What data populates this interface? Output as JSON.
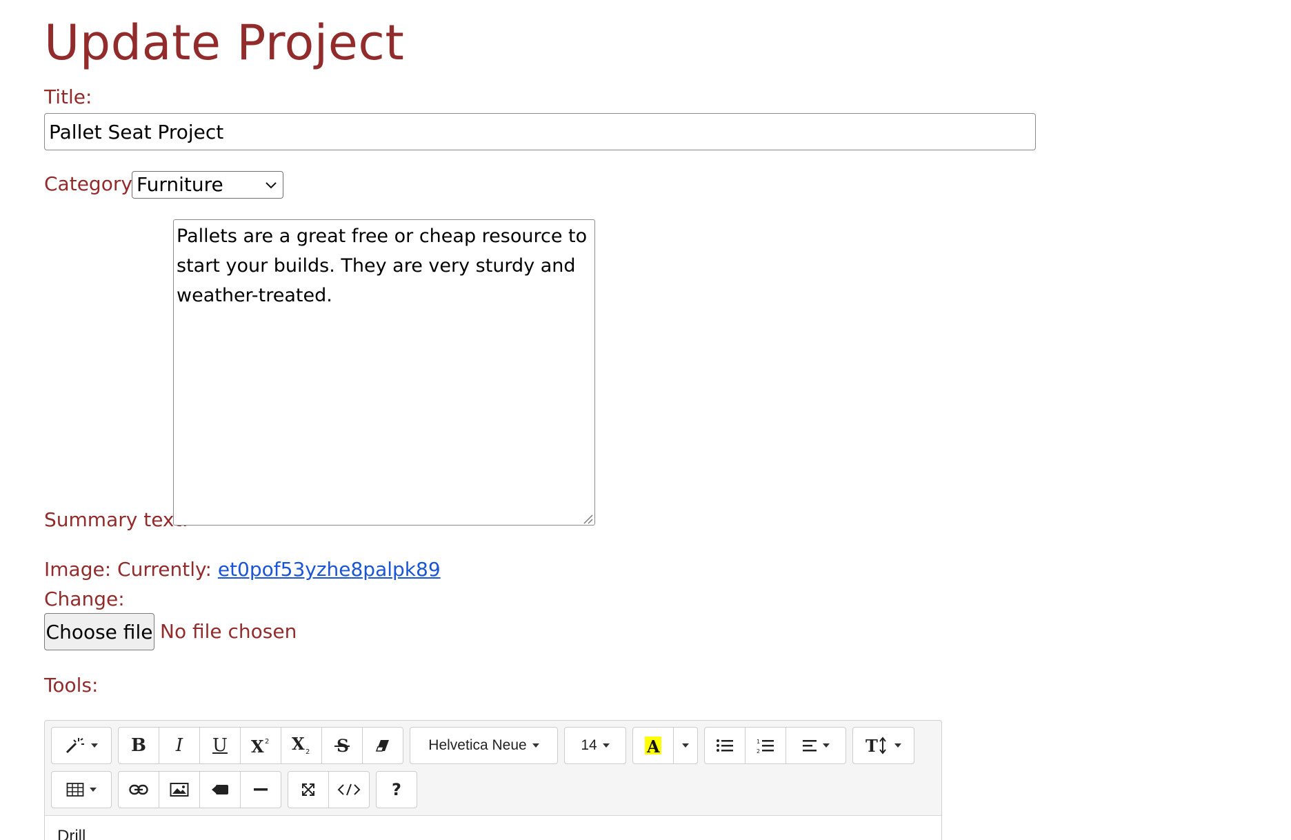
{
  "page": {
    "title": "Update Project"
  },
  "form": {
    "title_label": "Title:",
    "title_value": "Pallet Seat Project",
    "category_label": "Category:",
    "category_value": "Furniture",
    "summary_label": "Summary text:",
    "summary_value": "Pallets are a great free or cheap resource to start your builds. They are very sturdy and weather-treated.",
    "image_label": "Image: Currently:",
    "image_current": "et0pof53yzhe8palpk89",
    "change_label": "Change:",
    "choose_file_label": "Choose file",
    "no_file_text": "No file chosen",
    "tools_label": "Tools:"
  },
  "editor": {
    "font_name": "Helvetica Neue",
    "font_size": "14",
    "bold": "B",
    "italic": "I",
    "underline": "U",
    "help": "?",
    "content": "Drill",
    "icons": {
      "style": "magic-wand-icon",
      "bold": "bold-icon",
      "italic": "italic-icon",
      "underline": "underline-icon",
      "superscript": "superscript-icon",
      "subscript": "subscript-icon",
      "strikethrough": "strikethrough-icon",
      "clear": "eraser-icon",
      "color": "text-color-icon",
      "ul": "unordered-list-icon",
      "ol": "ordered-list-icon",
      "align": "align-icon",
      "height": "line-height-icon",
      "table": "table-icon",
      "link": "link-icon",
      "picture": "picture-icon",
      "video": "video-icon",
      "hr": "horizontal-rule-icon",
      "fullscreen": "fullscreen-icon",
      "code": "code-view-icon"
    }
  },
  "colors": {
    "accent": "#922b2b",
    "link": "#1a55d6",
    "highlight": "#ffff00"
  }
}
